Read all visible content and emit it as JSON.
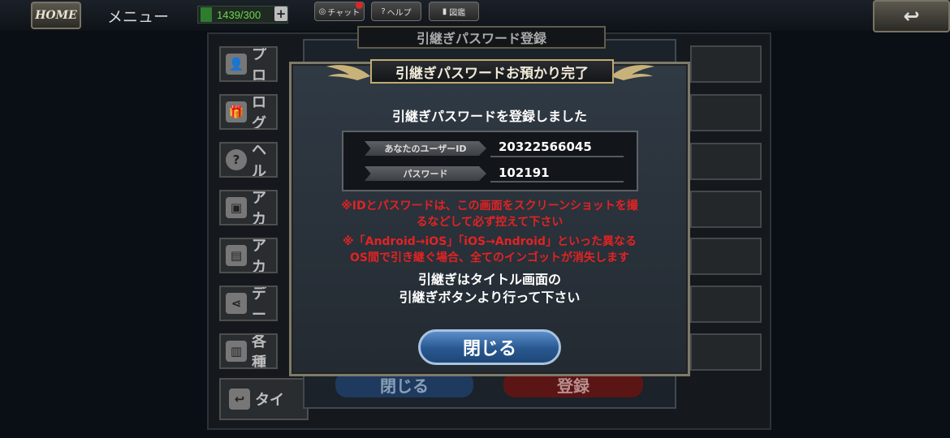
{
  "topbar": {
    "home_label": "HOME",
    "menu_title": "メニュー",
    "stamina": "1439/300",
    "plus": "+",
    "chat_label": "チャット",
    "help_label": "ヘルプ",
    "zukan_label": "図鑑",
    "back_icon": "↩"
  },
  "background_menu": {
    "items": [
      {
        "label": "プロ",
        "icon": "profile-icon"
      },
      {
        "label": "ログ",
        "icon": "gift-icon"
      },
      {
        "label": "ヘル",
        "icon": "help-icon"
      },
      {
        "label": "アカ",
        "icon": "account-icon"
      },
      {
        "label": "アカ",
        "icon": "account2-icon"
      },
      {
        "label": "デー",
        "icon": "share-icon"
      },
      {
        "label": "各種",
        "icon": "document-icon"
      },
      {
        "label": "タイ",
        "icon": "return-icon"
      }
    ]
  },
  "back_dialog": {
    "title": "引継ぎパスワード登録",
    "close_label": "閉じる",
    "register_label": "登録"
  },
  "dialog": {
    "title": "引継ぎパスワードお預かり完了",
    "message": "引継ぎパスワードを登録しました",
    "user_id_label": "あなたのユーザーID",
    "user_id_value": "20322566045",
    "password_label": "パスワード",
    "password_value": "102191",
    "warning1_line1": "※IDとパスワードは、この画面をスクリーンショットを撮",
    "warning1_line2": "るなどして必ず控えて下さい",
    "warning2_line1": "※「Android→iOS」「iOS→Android」といった異なる",
    "warning2_line2": "OS間で引き継ぐ場合、全てのインゴットが消失します",
    "note_line1": "引継ぎはタイトル画面の",
    "note_line2": "引継ぎボタンより行って下さい",
    "close_label": "閉じる"
  },
  "colors": {
    "warning": "#e22323",
    "close_button": "#2f63a0",
    "title_gold": "#c2ac72"
  }
}
